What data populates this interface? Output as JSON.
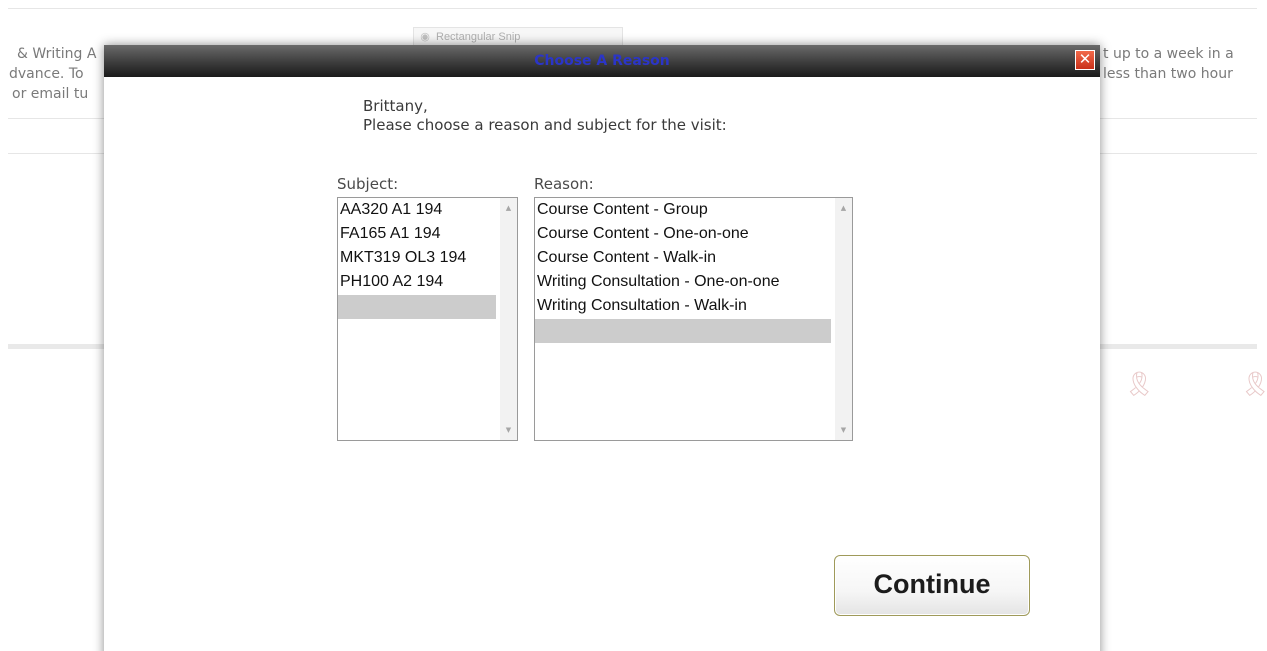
{
  "background": {
    "line1_left": "& Writing A",
    "line2_left": "dvance. To",
    "line3_left": "or email tu",
    "line1_right": "t up to a week in a",
    "line2_right": "less than two hour",
    "snip_tool_label": "Rectangular Snip"
  },
  "modal": {
    "title": "Choose A Reason",
    "title_color": "#2b35c8",
    "close_glyph": "✕",
    "greeting_name": "Brittany,",
    "instruction": "Please choose a reason and subject for the visit:",
    "subject": {
      "label": "Subject:",
      "options": [
        "AA320 A1 194",
        "FA165 A1 194",
        "MKT319 OL3 194",
        "PH100 A2 194",
        ""
      ],
      "selected_index": 4
    },
    "reason": {
      "label": "Reason:",
      "options": [
        "Course Content - Group",
        "Course Content - One-on-one",
        "Course Content - Walk-in",
        "Writing Consultation - One-on-one",
        "Writing Consultation - Walk-in",
        ""
      ],
      "selected_index": 5
    },
    "continue_label": "Continue"
  }
}
